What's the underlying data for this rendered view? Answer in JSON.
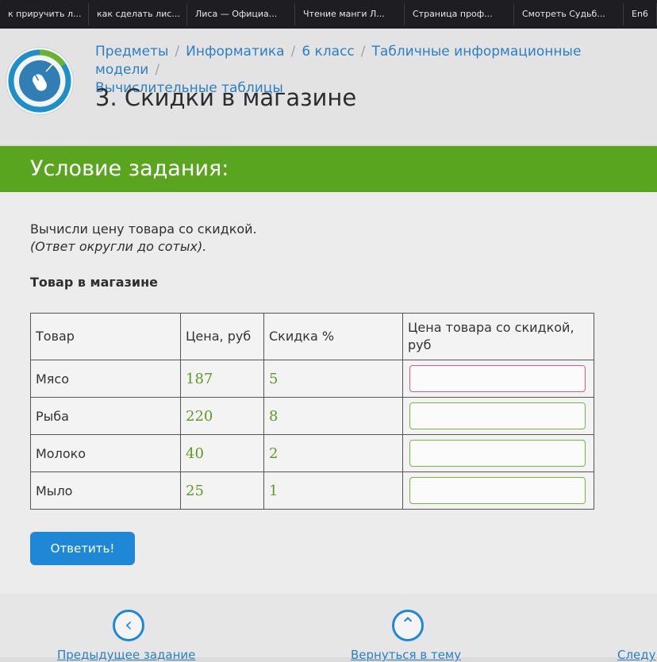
{
  "tabs": [
    "к приручить л...",
    "как сделать лис...",
    "Лиса — Официа...",
    "Чтение манги Л...",
    "Страница проф...",
    "Смотреть Судьб...",
    "En6"
  ],
  "breadcrumb": {
    "items": [
      "Предметы",
      "Информатика",
      "6 класс",
      "Табличные информационные модели",
      "Вычислительные таблицы"
    ],
    "separator": "/"
  },
  "page_title": "3. Скидки в магазине",
  "banner_title": "Условие задания:",
  "task": {
    "line1": "Вычисли цену товара со скидкой.",
    "line2": "(Ответ округли до сотых)."
  },
  "table_title": "Товар в магазине",
  "table": {
    "headers": [
      "Товар",
      "Цена, руб",
      "Скидка %",
      "Цена товара со скидкой, руб"
    ],
    "rows": [
      {
        "name": "Мясо",
        "price": "187",
        "discount": "5"
      },
      {
        "name": "Рыба",
        "price": "220",
        "discount": "8"
      },
      {
        "name": "Молоко",
        "price": "40",
        "discount": "2"
      },
      {
        "name": "Мыло",
        "price": "25",
        "discount": "1"
      }
    ]
  },
  "submit_label": "Ответить!",
  "bottom_nav": {
    "prev_label": "Предыдущее задание",
    "back_label": "Вернуться в тему",
    "next_label": "Следу"
  },
  "colors": {
    "banner": "#5aa51f",
    "link": "#2b7fc3",
    "button": "#1e88d6"
  }
}
